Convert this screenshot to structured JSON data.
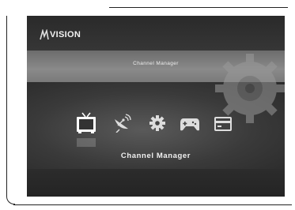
{
  "brand": {
    "logo_text": "VISION"
  },
  "screen": {
    "header_title": "Channel Manager",
    "selected_label": "Channel Manager"
  },
  "menu": {
    "items": [
      {
        "icon": "tv-icon",
        "selected": true
      },
      {
        "icon": "satellite-dish-icon",
        "selected": false
      },
      {
        "icon": "gear-icon",
        "selected": false
      },
      {
        "icon": "gamepad-icon",
        "selected": false
      },
      {
        "icon": "card-icon",
        "selected": false
      }
    ]
  }
}
